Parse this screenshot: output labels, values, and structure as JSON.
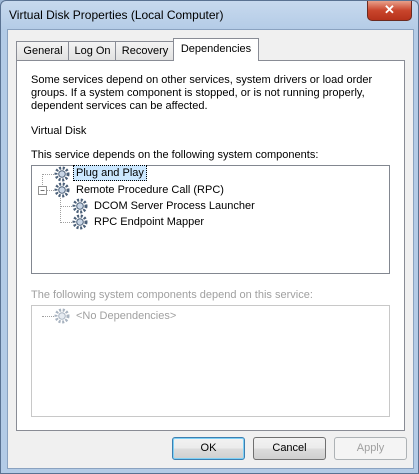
{
  "window": {
    "title": "Virtual Disk Properties (Local Computer)",
    "close_glyph": "✕"
  },
  "tabs": [
    {
      "label": "General",
      "active": false
    },
    {
      "label": "Log On",
      "active": false
    },
    {
      "label": "Recovery",
      "active": false
    },
    {
      "label": "Dependencies",
      "active": true
    }
  ],
  "panel": {
    "description": "Some services depend on other services, system drivers or load order groups. If a system component is stopped, or is not running properly, dependent services can be affected.",
    "service_name": "Virtual Disk",
    "depends_on_label": "This service depends on the following system components:",
    "depends_on_tree": [
      {
        "label": "Plug and Play",
        "selected": true
      },
      {
        "label": "Remote Procedure Call (RPC)",
        "expanded": true,
        "children": [
          {
            "label": "DCOM Server Process Launcher"
          },
          {
            "label": "RPC Endpoint Mapper"
          }
        ]
      }
    ],
    "dependents_label": "The following system components depend on this service:",
    "dependents_tree": [
      {
        "label": "<No Dependencies>"
      }
    ]
  },
  "buttons": {
    "ok": "OK",
    "cancel": "Cancel",
    "apply": "Apply"
  },
  "icons": {
    "service": "gear-icon",
    "expander": "minus-expander-icon"
  }
}
